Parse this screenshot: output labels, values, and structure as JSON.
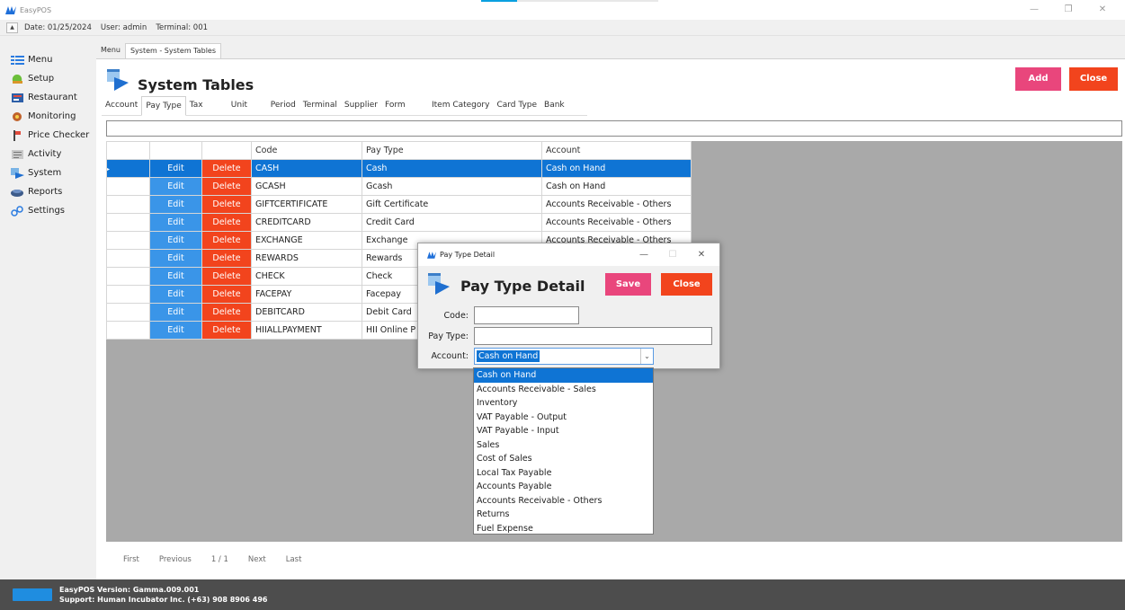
{
  "app": {
    "title": "EasyPOS",
    "window_controls": [
      "—",
      "❐",
      "✕"
    ]
  },
  "infobar": {
    "collapse_glyph": "▲",
    "date": "Date: 01/25/2024",
    "user": "User: admin",
    "terminal": "Terminal: 001"
  },
  "sidebar": {
    "items": [
      {
        "label": "Menu",
        "icon": "menu-icon"
      },
      {
        "label": "Setup",
        "icon": "setup-icon"
      },
      {
        "label": "Restaurant",
        "icon": "restaurant-icon"
      },
      {
        "label": "Monitoring",
        "icon": "monitoring-icon"
      },
      {
        "label": "Price Checker",
        "icon": "price-checker-icon"
      },
      {
        "label": "Activity",
        "icon": "activity-icon"
      },
      {
        "label": "System",
        "icon": "system-icon"
      },
      {
        "label": "Reports",
        "icon": "reports-icon"
      },
      {
        "label": "Settings",
        "icon": "settings-icon"
      }
    ]
  },
  "main_tabs": [
    "Menu",
    "System - System Tables"
  ],
  "page": {
    "title": "System Tables",
    "add_label": "Add",
    "close_label": "Close"
  },
  "sub_tabs": [
    "Account",
    "Pay Type",
    "Tax",
    "Unit",
    "Period",
    "Terminal",
    "Supplier",
    "Form",
    "Item Category",
    "Card Type",
    "Bank"
  ],
  "sub_tabs_active": "Pay Type",
  "grid": {
    "columns": [
      "",
      "",
      "",
      "Code",
      "Pay Type",
      "Account"
    ],
    "edit_label": "Edit",
    "delete_label": "Delete",
    "row_marker": "▸",
    "rows": [
      {
        "code": "CASH",
        "pay_type": "Cash",
        "account": "Cash on Hand"
      },
      {
        "code": "GCASH",
        "pay_type": "Gcash",
        "account": "Cash on Hand"
      },
      {
        "code": "GIFTCERTIFICATE",
        "pay_type": "Gift Certificate",
        "account": "Accounts Receivable - Others"
      },
      {
        "code": "CREDITCARD",
        "pay_type": "Credit Card",
        "account": "Accounts Receivable - Others"
      },
      {
        "code": "EXCHANGE",
        "pay_type": "Exchange",
        "account": "Accounts Receivable - Others"
      },
      {
        "code": "REWARDS",
        "pay_type": "Rewards",
        "account": ""
      },
      {
        "code": "CHECK",
        "pay_type": "Check",
        "account": ""
      },
      {
        "code": "FACEPAY",
        "pay_type": "Facepay",
        "account": ""
      },
      {
        "code": "DEBITCARD",
        "pay_type": "Debit Card",
        "account": ""
      },
      {
        "code": "HIIALLPAYMENT",
        "pay_type": "HII Online P",
        "account": ""
      }
    ]
  },
  "pager": {
    "first": "First",
    "previous": "Previous",
    "page": "1 / 1",
    "next": "Next",
    "last": "Last"
  },
  "status": {
    "version": "EasyPOS Version: Gamma.009.001",
    "support": "Support: Human Incubator Inc. (+63) 908 8906 496"
  },
  "dialog": {
    "window_title": "Pay Type Detail",
    "heading": "Pay Type Detail",
    "save_label": "Save",
    "close_label": "Close",
    "code_label": "Code:",
    "code_value": "",
    "pay_type_label": "Pay Type:",
    "pay_type_value": "",
    "account_label": "Account:",
    "account_value": "Cash on Hand",
    "combo_arrow": "⌄",
    "window_controls": [
      "—",
      "☐",
      "✕"
    ]
  },
  "dropdown": {
    "options": [
      "Cash on Hand",
      "Accounts Receivable - Sales",
      "Inventory",
      "VAT Payable - Output",
      "VAT Payable - Input",
      "Sales",
      "Cost of Sales",
      "Local Tax Payable",
      "Accounts Payable",
      "Accounts Receivable - Others",
      "Returns",
      "Fuel Expense"
    ],
    "highlighted": "Cash on Hand"
  },
  "colors": {
    "add": "#e9467c",
    "close": "#f2441d",
    "edit": "#3a95e8",
    "selection": "#0f74d4",
    "statusbar": "#4d4d4d"
  }
}
